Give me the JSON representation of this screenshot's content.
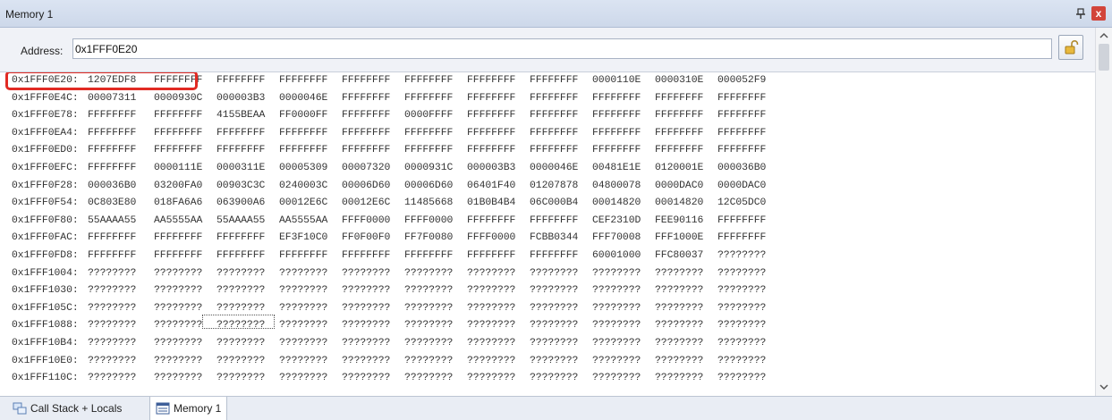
{
  "window": {
    "title": "Memory 1",
    "close_glyph": "x"
  },
  "address": {
    "label": "Address:",
    "value": "0x1FFF0E20"
  },
  "rows": [
    {
      "addr": "0x1FFF0E20:",
      "values": [
        "1207EDF8",
        "FFFFFFFF",
        "FFFFFFFF",
        "FFFFFFFF",
        "FFFFFFFF",
        "FFFFFFFF",
        "FFFFFFFF",
        "FFFFFFFF",
        "0000110E",
        "0000310E",
        "000052F9"
      ]
    },
    {
      "addr": "0x1FFF0E4C:",
      "values": [
        "00007311",
        "0000930C",
        "000003B3",
        "0000046E",
        "FFFFFFFF",
        "FFFFFFFF",
        "FFFFFFFF",
        "FFFFFFFF",
        "FFFFFFFF",
        "FFFFFFFF",
        "FFFFFFFF"
      ]
    },
    {
      "addr": "0x1FFF0E78:",
      "values": [
        "FFFFFFFF",
        "FFFFFFFF",
        "4155BEAA",
        "FF0000FF",
        "FFFFFFFF",
        "0000FFFF",
        "FFFFFFFF",
        "FFFFFFFF",
        "FFFFFFFF",
        "FFFFFFFF",
        "FFFFFFFF"
      ]
    },
    {
      "addr": "0x1FFF0EA4:",
      "values": [
        "FFFFFFFF",
        "FFFFFFFF",
        "FFFFFFFF",
        "FFFFFFFF",
        "FFFFFFFF",
        "FFFFFFFF",
        "FFFFFFFF",
        "FFFFFFFF",
        "FFFFFFFF",
        "FFFFFFFF",
        "FFFFFFFF"
      ]
    },
    {
      "addr": "0x1FFF0ED0:",
      "values": [
        "FFFFFFFF",
        "FFFFFFFF",
        "FFFFFFFF",
        "FFFFFFFF",
        "FFFFFFFF",
        "FFFFFFFF",
        "FFFFFFFF",
        "FFFFFFFF",
        "FFFFFFFF",
        "FFFFFFFF",
        "FFFFFFFF"
      ]
    },
    {
      "addr": "0x1FFF0EFC:",
      "values": [
        "FFFFFFFF",
        "0000111E",
        "0000311E",
        "00005309",
        "00007320",
        "0000931C",
        "000003B3",
        "0000046E",
        "00481E1E",
        "0120001E",
        "000036B0"
      ]
    },
    {
      "addr": "0x1FFF0F28:",
      "values": [
        "000036B0",
        "03200FA0",
        "00903C3C",
        "0240003C",
        "00006D60",
        "00006D60",
        "06401F40",
        "01207878",
        "04800078",
        "0000DAC0",
        "0000DAC0"
      ]
    },
    {
      "addr": "0x1FFF0F54:",
      "values": [
        "0C803E80",
        "018FA6A6",
        "063900A6",
        "00012E6C",
        "00012E6C",
        "11485668",
        "01B0B4B4",
        "06C000B4",
        "00014820",
        "00014820",
        "12C05DC0"
      ]
    },
    {
      "addr": "0x1FFF0F80:",
      "values": [
        "55AAAA55",
        "AA5555AA",
        "55AAAA55",
        "AA5555AA",
        "FFFF0000",
        "FFFF0000",
        "FFFFFFFF",
        "FFFFFFFF",
        "CEF2310D",
        "FEE90116",
        "FFFFFFFF"
      ]
    },
    {
      "addr": "0x1FFF0FAC:",
      "values": [
        "FFFFFFFF",
        "FFFFFFFF",
        "FFFFFFFF",
        "EF3F10C0",
        "FF0F00F0",
        "FF7F0080",
        "FFFF0000",
        "FCBB0344",
        "FFF70008",
        "FFF1000E",
        "FFFFFFFF"
      ]
    },
    {
      "addr": "0x1FFF0FD8:",
      "values": [
        "FFFFFFFF",
        "FFFFFFFF",
        "FFFFFFFF",
        "FFFFFFFF",
        "FFFFFFFF",
        "FFFFFFFF",
        "FFFFFFFF",
        "FFFFFFFF",
        "60001000",
        "FFC80037",
        "????????"
      ]
    },
    {
      "addr": "0x1FFF1004:",
      "values": [
        "????????",
        "????????",
        "????????",
        "????????",
        "????????",
        "????????",
        "????????",
        "????????",
        "????????",
        "????????",
        "????????"
      ]
    },
    {
      "addr": "0x1FFF1030:",
      "values": [
        "????????",
        "????????",
        "????????",
        "????????",
        "????????",
        "????????",
        "????????",
        "????????",
        "????????",
        "????????",
        "????????"
      ]
    },
    {
      "addr": "0x1FFF105C:",
      "values": [
        "????????",
        "????????",
        "????????",
        "????????",
        "????????",
        "????????",
        "????????",
        "????????",
        "????????",
        "????????",
        "????????"
      ]
    },
    {
      "addr": "0x1FFF1088:",
      "values": [
        "????????",
        "????????",
        "????????",
        "????????",
        "????????",
        "????????",
        "????????",
        "????????",
        "????????",
        "????????",
        "????????"
      ]
    },
    {
      "addr": "0x1FFF10B4:",
      "values": [
        "????????",
        "????????",
        "????????",
        "????????",
        "????????",
        "????????",
        "????????",
        "????????",
        "????????",
        "????????",
        "????????"
      ]
    },
    {
      "addr": "0x1FFF10E0:",
      "values": [
        "????????",
        "????????",
        "????????",
        "????????",
        "????????",
        "????????",
        "????????",
        "????????",
        "????????",
        "????????",
        "????????"
      ]
    },
    {
      "addr": "0x1FFF110C:",
      "values": [
        "????????",
        "????????",
        "????????",
        "????????",
        "????????",
        "????????",
        "????????",
        "????????",
        "????????",
        "????????",
        "????????"
      ]
    }
  ],
  "tabs": [
    {
      "label": "Call Stack + Locals",
      "icon": "call-stack-icon",
      "active": false
    },
    {
      "label": "Memory 1",
      "icon": "memory-icon",
      "active": true
    }
  ],
  "colors": {
    "highlight": "#e12a23",
    "titlebar": "#cdd8ea",
    "close": "#d2443a"
  }
}
